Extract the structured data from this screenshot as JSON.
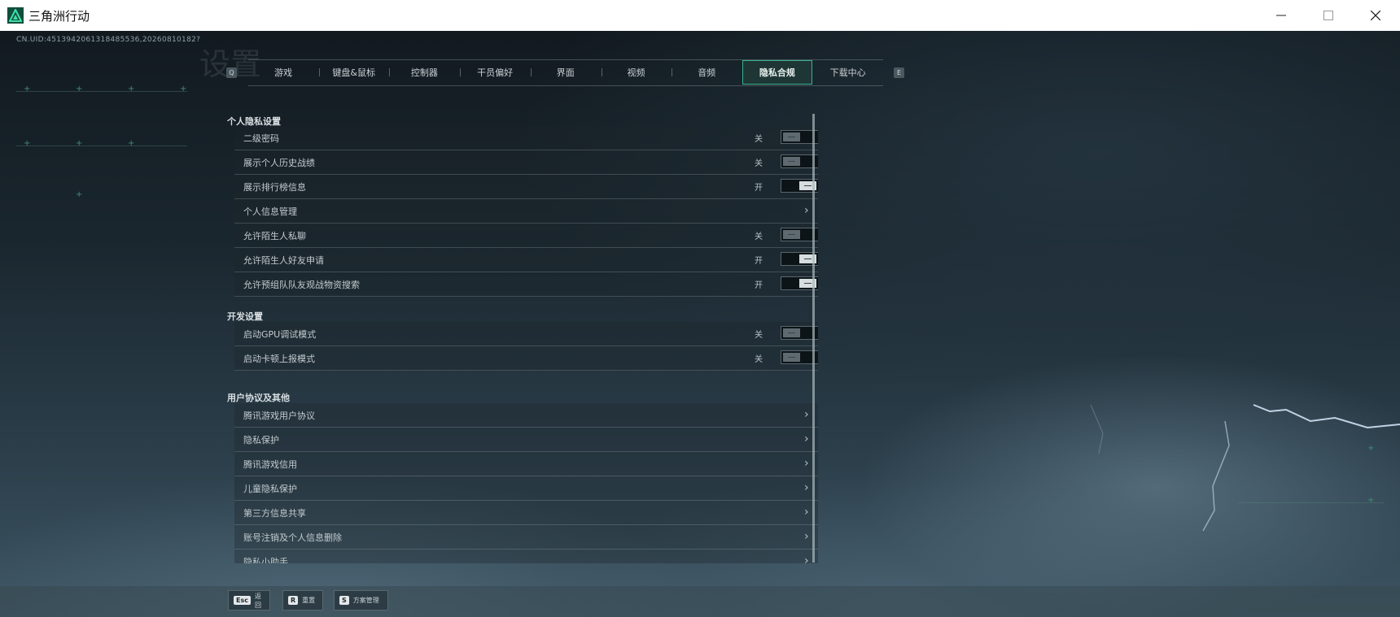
{
  "window": {
    "title": "三角洲行动",
    "controls": {
      "minimize": "—",
      "maximize": "☐",
      "close": "✕"
    }
  },
  "uid": "CN.UID:4513942061318485536,20260810182?",
  "tab_keys": {
    "prev": "Q",
    "next": "E"
  },
  "tabs": [
    {
      "label": "游戏",
      "active": false
    },
    {
      "label": "键盘&鼠标",
      "active": false
    },
    {
      "label": "控制器",
      "active": false
    },
    {
      "label": "干员偏好",
      "active": false
    },
    {
      "label": "界面",
      "active": false
    },
    {
      "label": "视频",
      "active": false
    },
    {
      "label": "音频",
      "active": false
    },
    {
      "label": "隐私合规",
      "active": true
    },
    {
      "label": "下载中心",
      "active": false
    }
  ],
  "sections": {
    "personal": {
      "title": "个人隐私设置",
      "rows": [
        {
          "label": "二级密码",
          "state": "关",
          "type": "toggle-off"
        },
        {
          "label": "展示个人历史战绩",
          "state": "关",
          "type": "toggle-off"
        },
        {
          "label": "展示排行榜信息",
          "state": "开",
          "type": "toggle-on"
        },
        {
          "label": "个人信息管理",
          "type": "link"
        },
        {
          "label": "允许陌生人私聊",
          "state": "关",
          "type": "toggle-off"
        },
        {
          "label": "允许陌生人好友申请",
          "state": "开",
          "type": "toggle-on"
        },
        {
          "label": "允许预组队队友观战物资搜索",
          "state": "开",
          "type": "toggle-on"
        }
      ]
    },
    "dev": {
      "title": "开发设置",
      "rows": [
        {
          "label": "启动GPU调试模式",
          "state": "关",
          "type": "toggle-off"
        },
        {
          "label": "启动卡顿上报模式",
          "state": "关",
          "type": "toggle-off"
        }
      ]
    },
    "agreements": {
      "title": "用户协议及其他",
      "rows": [
        {
          "label": "腾讯游戏用户协议",
          "type": "link"
        },
        {
          "label": "隐私保护",
          "type": "link"
        },
        {
          "label": "腾讯游戏信用",
          "type": "link"
        },
        {
          "label": "儿童隐私保护",
          "type": "link"
        },
        {
          "label": "第三方信息共享",
          "type": "link"
        },
        {
          "label": "账号注销及个人信息删除",
          "type": "link"
        },
        {
          "label": "隐私小助手",
          "type": "link"
        }
      ]
    }
  },
  "bottom_buttons": [
    {
      "key": "Esc",
      "label": "返回"
    },
    {
      "key": "R",
      "label": "重置"
    },
    {
      "key": "S",
      "label": "方案管理"
    }
  ],
  "icons": {
    "chevron": "chevron-right-icon",
    "app": "delta-logo-icon"
  },
  "colors": {
    "accent": "#37b28c",
    "background": "#1a262e"
  }
}
